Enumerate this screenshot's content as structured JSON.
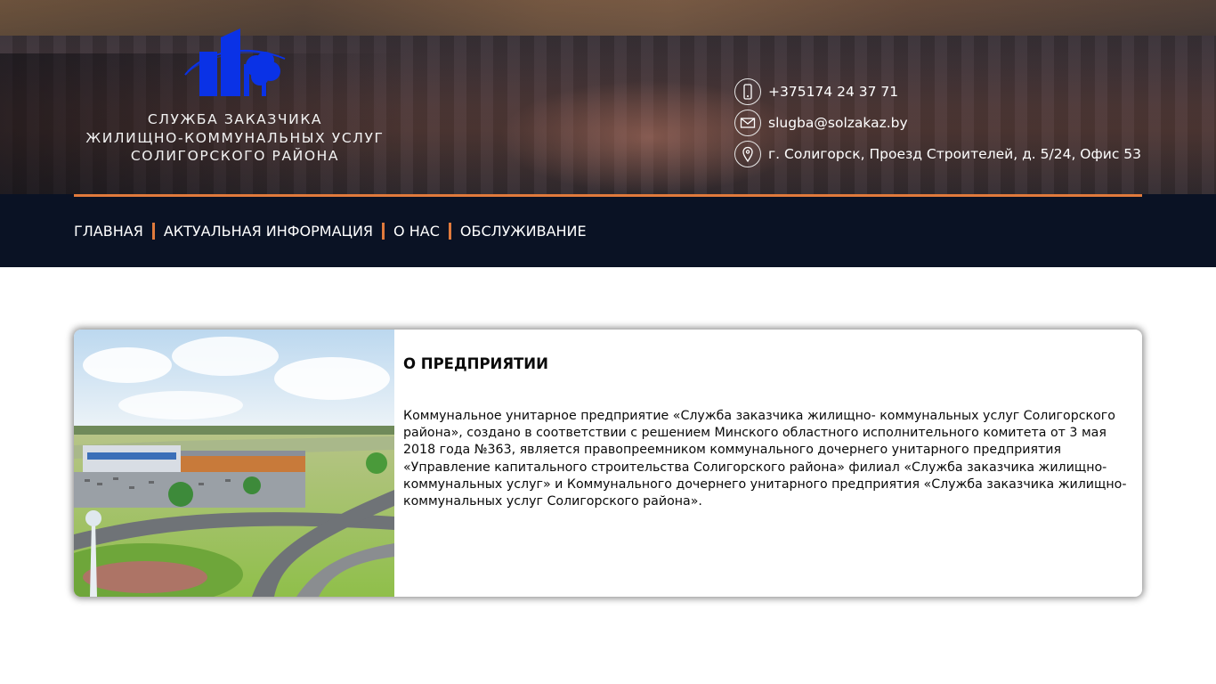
{
  "brand": {
    "line1": "СЛУЖБА ЗАКАЗЧИКА",
    "line2": "ЖИЛИЩНО-КОММУНАЛЬНЫХ УСЛУГ",
    "line3": "СОЛИГОРСКОГО РАЙОНА",
    "logo_icon": "building-tree-logo-icon",
    "logo_color": "#0a32e6"
  },
  "contacts": {
    "phone": "+375174 24 37 71",
    "email": "slugba@solzakaz.by",
    "address": "г. Солигорск, Проезд Строителей, д. 5/24, Офис 53"
  },
  "nav": {
    "items": [
      "ГЛАВНАЯ",
      "АКТУАЛЬНАЯ ИНФОРМАЦИЯ",
      "О НАС",
      "ОБСЛУЖИВАНИЕ"
    ],
    "accent": "#e07a3c",
    "background": "#0a1224"
  },
  "about": {
    "title": "О ПРЕДПРИЯТИИ",
    "text": "Коммунальное унитарное предприятие «Служба заказчика жилищно- коммунальных услуг Солигорского района», создано в соответствии с решением Минского областного исполнительного комитета от 3 мая 2018 года №363, является правопреемником коммунального дочернего унитарного предприятия «Управление капитального строительства Солигорского района» филиал «Служба заказчика жилищно-коммунальных услуг» и Коммунального дочернего унитарного предприятия «Служба заказчика жилищно-коммунальных услуг Солигорского района»."
  }
}
